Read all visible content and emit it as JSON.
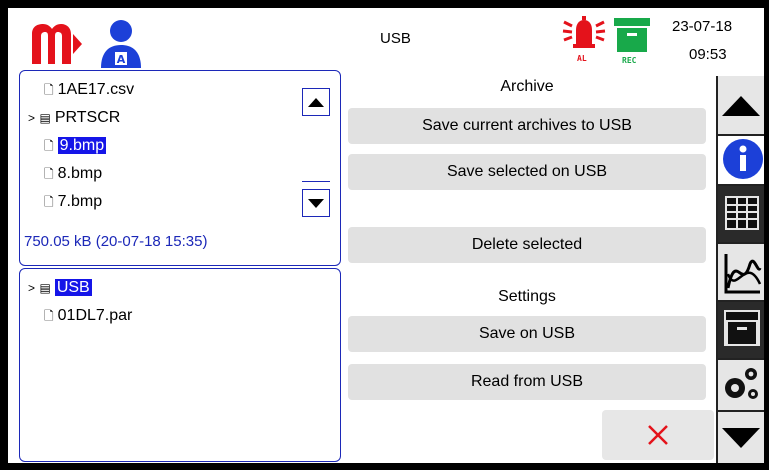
{
  "header": {
    "title": "USB",
    "date": "23-07-18",
    "time": "09:53",
    "alarm_badge": "AL",
    "rec_badge": "REC"
  },
  "file_browser": {
    "items": [
      {
        "icon": "file-icon",
        "name": "1AE17.csv",
        "selected": false
      },
      {
        "icon": "folder-icon",
        "name": "PRTSCR",
        "expander": ">",
        "selected": false
      },
      {
        "icon": "file-icon",
        "name": "9.bmp",
        "selected": true
      },
      {
        "icon": "file-icon",
        "name": "8.bmp",
        "selected": false
      },
      {
        "icon": "file-icon",
        "name": "7.bmp",
        "selected": false
      }
    ],
    "file_info": "750.05 kB (20-07-18 15:35)"
  },
  "drive_browser": {
    "items": [
      {
        "icon": "folder-icon",
        "name": "USB",
        "expander": ">",
        "selected": true
      },
      {
        "icon": "file-icon",
        "name": "01DL7.par",
        "selected": false
      }
    ]
  },
  "actions": {
    "archive_label": "Archive",
    "save_current": "Save current archives to USB",
    "save_selected": "Save selected on USB",
    "delete_selected": "Delete selected",
    "settings_label": "Settings",
    "save_on_usb": "Save on USB",
    "read_from_usb": "Read from USB",
    "close_icon": "close-icon"
  },
  "side_nav": [
    "up-arrow-icon",
    "info-icon",
    "table-icon",
    "chart-icon",
    "archive-icon",
    "settings-gears-icon",
    "down-arrow-icon"
  ],
  "colors": {
    "brand_red": "#e4121b",
    "user_blue": "#1c40d8",
    "rec_green": "#18a94a",
    "selection_blue": "#1515e8",
    "panel_border": "#1c28b8",
    "nav_dark": "#2a2a2a"
  }
}
